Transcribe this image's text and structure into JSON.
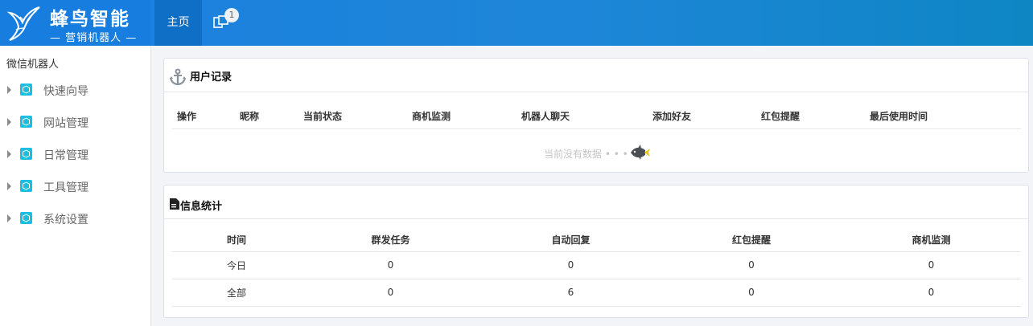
{
  "header": {
    "logo_title": "蜂鸟智能",
    "logo_subtitle": "— 营销机器人 —",
    "nav_home": "主页",
    "windows_badge": "1"
  },
  "sidebar": {
    "title": "微信机器人",
    "items": [
      {
        "label": "快速向导"
      },
      {
        "label": "网站管理"
      },
      {
        "label": "日常管理"
      },
      {
        "label": "工具管理"
      },
      {
        "label": "系统设置"
      }
    ]
  },
  "user_records": {
    "title": "用户记录",
    "columns": [
      "操作",
      "昵称",
      "当前状态",
      "商机监测",
      "机器人聊天",
      "添加好友",
      "红包提醒",
      "最后使用时间"
    ],
    "empty_text": "当前没有数据 • • •"
  },
  "stats": {
    "title": "信息统计",
    "columns": [
      "时间",
      "群发任务",
      "自动回复",
      "红包提醒",
      "商机监测"
    ],
    "rows": [
      [
        "今日",
        "0",
        "0",
        "0",
        "0"
      ],
      [
        "全部",
        "0",
        "6",
        "0",
        "0"
      ]
    ]
  },
  "colors": {
    "header_gradient_start": "#1a7fe0",
    "header_gradient_end": "#0e86c4",
    "nav_active": "#0f6fc7",
    "sidebar_icon": "#1bbde0"
  }
}
